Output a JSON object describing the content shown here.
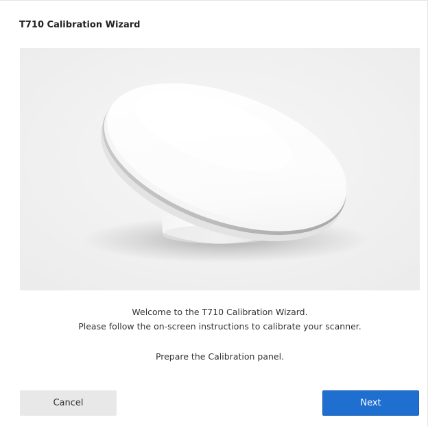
{
  "dialog": {
    "title": "T710 Calibration Wizard"
  },
  "main": {
    "image_alt": "calibration-panel-device",
    "messages": [
      "Welcome to the T710 Calibration Wizard.",
      "Please follow the on-screen instructions to calibrate your scanner.",
      "Prepare the Calibration panel."
    ]
  },
  "footer": {
    "cancel_label": "Cancel",
    "next_label": "Next"
  },
  "colors": {
    "accent": "#1f6fd1",
    "panel_background": "#f0f0f0",
    "secondary_button": "#e8e8e8"
  }
}
